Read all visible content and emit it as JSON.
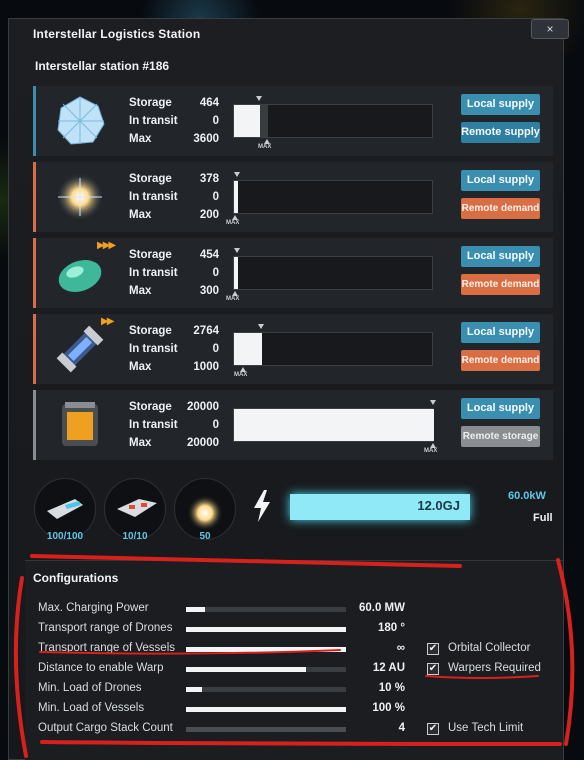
{
  "window": {
    "title": "Interstellar Logistics Station",
    "close_label": "×",
    "station_name": "Interstellar station #186"
  },
  "labels": {
    "storage": "Storage",
    "in_transit": "In transit",
    "max": "Max",
    "max_marker": "MAX"
  },
  "slots": [
    {
      "icon": "casimir-crystal-icon",
      "accent": "#3a8fb0",
      "storage": "464",
      "in_transit": "0",
      "max": "3600",
      "fill": 0.129,
      "max_fraction": 0.17,
      "local": "Local supply",
      "remote": "Remote supply",
      "remote_type": "remote-supply",
      "arrows": ""
    },
    {
      "icon": "star-burst-icon",
      "accent": "#d96d43",
      "storage": "378",
      "in_transit": "0",
      "max": "200",
      "fill": 0.02,
      "max_fraction": 0.01,
      "local": "Local supply",
      "remote": "Remote demand",
      "remote_type": "remote-demand",
      "arrows": ""
    },
    {
      "icon": "green-gem-icon",
      "accent": "#d96d43",
      "storage": "454",
      "in_transit": "0",
      "max": "300",
      "fill": 0.02,
      "max_fraction": 0.01,
      "local": "Local supply",
      "remote": "Remote demand",
      "remote_type": "remote-demand",
      "arrows": "▶▶▶"
    },
    {
      "icon": "capsule-icon",
      "accent": "#d96d43",
      "storage": "2764",
      "in_transit": "0",
      "max": "1000",
      "fill": 0.14,
      "max_fraction": 0.05,
      "local": "Local supply",
      "remote": "Remote demand",
      "remote_type": "remote-demand",
      "arrows": "▶▶"
    },
    {
      "icon": "fuel-canister-icon",
      "accent": "#8a8d91",
      "storage": "20000",
      "in_transit": "0",
      "max": "20000",
      "fill": 1.0,
      "max_fraction": 1.0,
      "local": "Local supply",
      "remote": "Remote storage",
      "remote_type": "remote-storage",
      "arrows": ""
    }
  ],
  "fleet": [
    {
      "icon": "drone-icon",
      "count": "100/100"
    },
    {
      "icon": "vessel-icon",
      "count": "10/10"
    },
    {
      "icon": "warper-icon",
      "count": "50"
    }
  ],
  "energy": {
    "icon": "lightning-icon",
    "stored": "12.0GJ",
    "fraction": 1.0,
    "power": "60.0kW",
    "status": "Full"
  },
  "config": {
    "title": "Configurations",
    "rows": [
      {
        "label": "Max. Charging Power",
        "value": "60.0 MW",
        "fraction": 0.12,
        "dim": false
      },
      {
        "label": "Transport range of Drones",
        "value": "180 °",
        "fraction": 1.0,
        "dim": false
      },
      {
        "label": "Transport range of Vessels",
        "value": "∞",
        "fraction": 1.0,
        "dim": false
      },
      {
        "label": "Distance to enable Warp",
        "value": "12 AU",
        "fraction": 0.75,
        "dim": false
      },
      {
        "label": "Min. Load of Drones",
        "value": "10 %",
        "fraction": 0.1,
        "dim": false
      },
      {
        "label": "Min. Load of Vessels",
        "value": "100 %",
        "fraction": 1.0,
        "dim": false
      },
      {
        "label": "Output Cargo Stack Count",
        "value": "4",
        "fraction": 1.0,
        "dim": true
      }
    ],
    "checks": [
      {
        "label": "Orbital Collector",
        "checked": true
      },
      {
        "label": "Warpers Required",
        "checked": true
      },
      {
        "label": "Use Tech Limit",
        "checked": true
      }
    ],
    "check_mark": "✔"
  }
}
